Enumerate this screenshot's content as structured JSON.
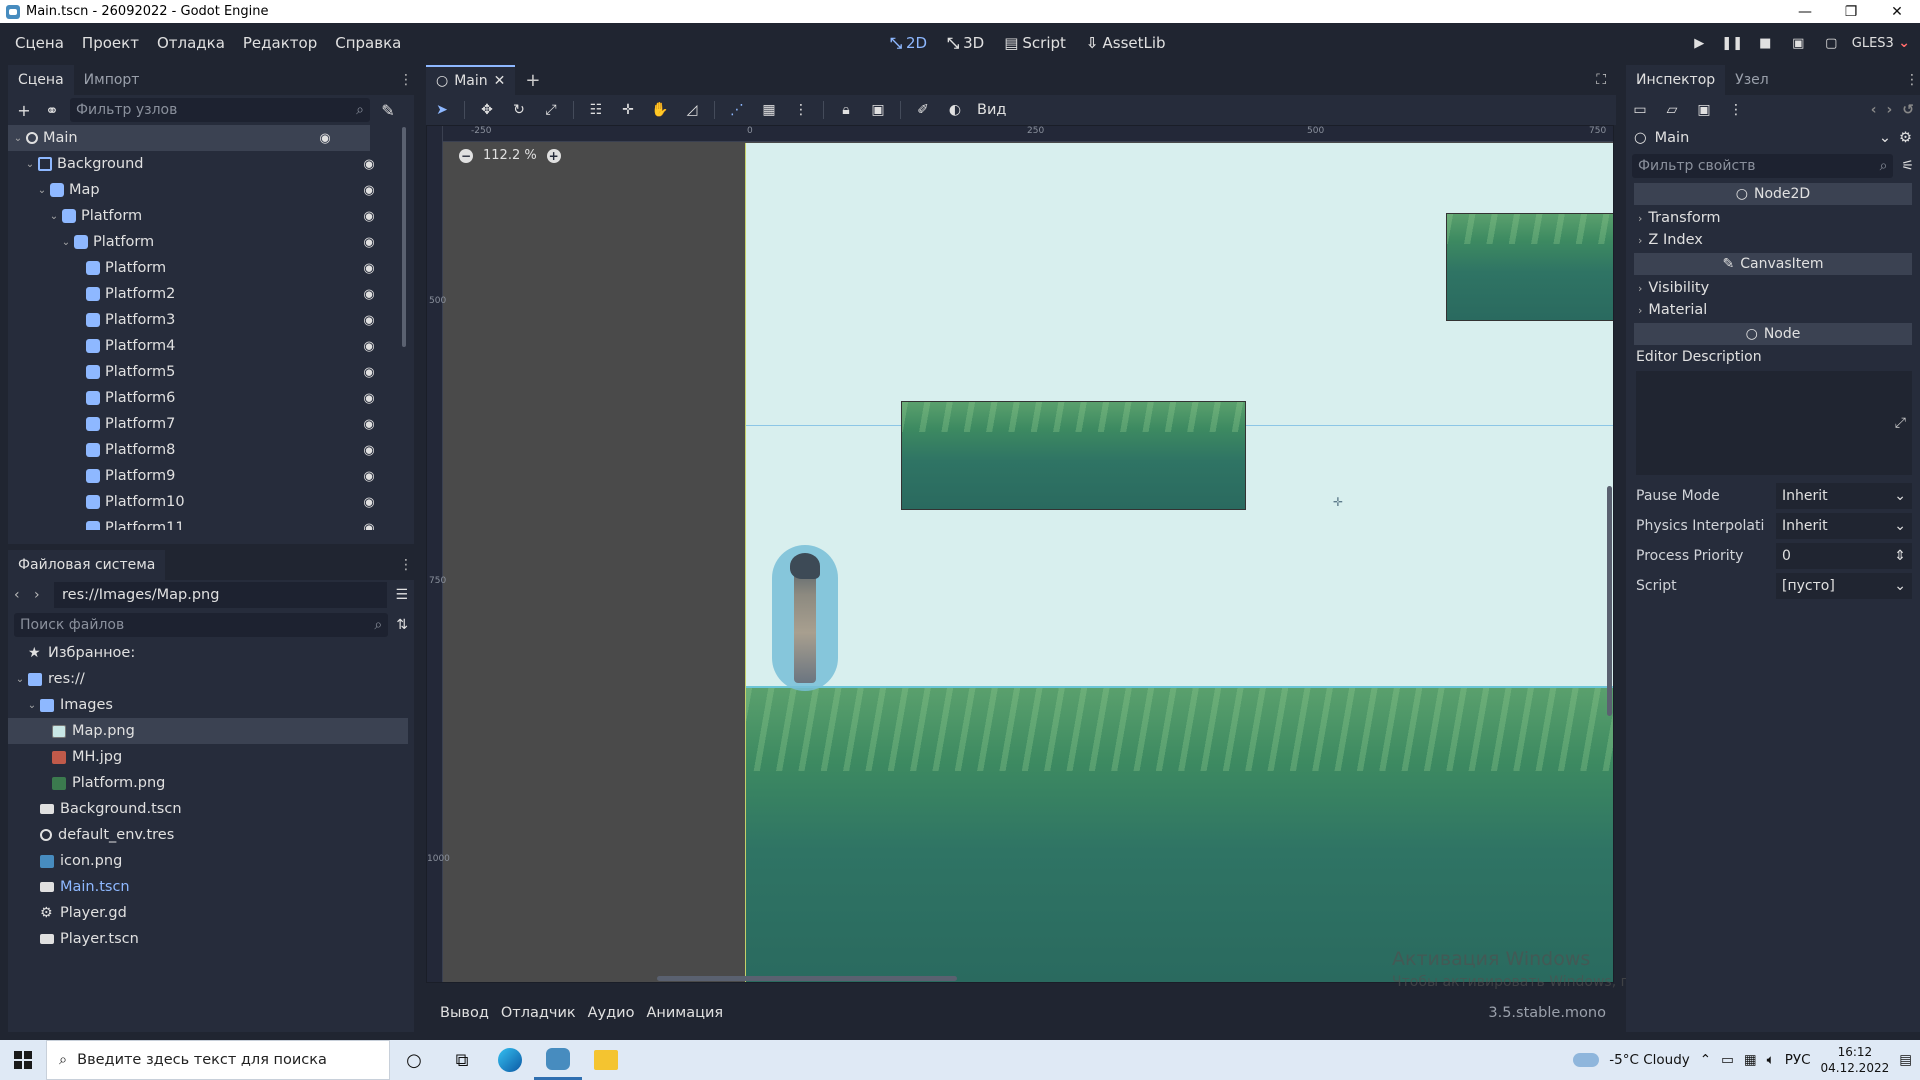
{
  "window": {
    "title": "Main.tscn - 26092022 - Godot Engine",
    "controls": [
      "—",
      "❐",
      "✕"
    ]
  },
  "menubar": {
    "menu": [
      "Сцена",
      "Проект",
      "Отладка",
      "Редактор",
      "Справка"
    ],
    "modes": [
      {
        "label": "2D",
        "icon": "2d-icon",
        "active": true
      },
      {
        "label": "3D",
        "icon": "3d-icon",
        "active": false
      },
      {
        "label": "Script",
        "icon": "script-icon",
        "active": false
      },
      {
        "label": "AssetLib",
        "icon": "assetlib-icon",
        "active": false
      }
    ],
    "renderer": "GLES3"
  },
  "scene_dock": {
    "tabs": [
      "Сцена",
      "Импорт"
    ],
    "filter_placeholder": "Фильтр узлов",
    "tree": [
      {
        "label": "Main",
        "type": "node",
        "depth": 0,
        "expanded": true,
        "selected": true
      },
      {
        "label": "Background",
        "type": "bg",
        "depth": 1,
        "expanded": true
      },
      {
        "label": "Map",
        "type": "tile",
        "depth": 2,
        "expanded": true
      },
      {
        "label": "Platform",
        "type": "tile",
        "depth": 3,
        "expanded": true
      },
      {
        "label": "Platform",
        "type": "tile",
        "depth": 4,
        "expanded": true
      },
      {
        "label": "Platform",
        "type": "tile",
        "depth": 5
      },
      {
        "label": "Platform2",
        "type": "tile",
        "depth": 5
      },
      {
        "label": "Platform3",
        "type": "tile",
        "depth": 5
      },
      {
        "label": "Platform4",
        "type": "tile",
        "depth": 5
      },
      {
        "label": "Platform5",
        "type": "tile",
        "depth": 5
      },
      {
        "label": "Platform6",
        "type": "tile",
        "depth": 5
      },
      {
        "label": "Platform7",
        "type": "tile",
        "depth": 5
      },
      {
        "label": "Platform8",
        "type": "tile",
        "depth": 5
      },
      {
        "label": "Platform9",
        "type": "tile",
        "depth": 5
      },
      {
        "label": "Platform10",
        "type": "tile",
        "depth": 5
      },
      {
        "label": "Platform11",
        "type": "tile",
        "depth": 5
      }
    ]
  },
  "filesystem_dock": {
    "title": "Файловая система",
    "path": "res://Images/Map.png",
    "search_placeholder": "Поиск файлов",
    "entries": [
      {
        "label": "Избранное:",
        "icon": "star",
        "depth": 0
      },
      {
        "label": "res://",
        "icon": "folder",
        "depth": 0,
        "expanded": true
      },
      {
        "label": "Images",
        "icon": "folder",
        "depth": 1,
        "expanded": true
      },
      {
        "label": "Map.png",
        "icon": "img",
        "depth": 2,
        "selected": true
      },
      {
        "label": "MH.jpg",
        "icon": "jpg",
        "depth": 2
      },
      {
        "label": "Platform.png",
        "icon": "plat",
        "depth": 2
      },
      {
        "label": "Background.tscn",
        "icon": "scene",
        "depth": 1
      },
      {
        "label": "default_env.tres",
        "icon": "env",
        "depth": 1
      },
      {
        "label": "icon.png",
        "icon": "icon",
        "depth": 1
      },
      {
        "label": "Main.tscn",
        "icon": "scene",
        "depth": 1,
        "highlight": true
      },
      {
        "label": "Player.gd",
        "icon": "gear",
        "depth": 1
      },
      {
        "label": "Player.tscn",
        "icon": "scene",
        "depth": 1
      }
    ]
  },
  "center": {
    "scene_tab": "Main",
    "view_menu": "Вид",
    "zoom": "112.2 %",
    "ruler_top": [
      "-250",
      "0",
      "250",
      "500",
      "750"
    ],
    "ruler_left": [
      "500",
      "750",
      "1000"
    ]
  },
  "watermark": {
    "title": "Активация Windows",
    "subtitle": "Чтобы активировать Windows, перейдите в раздел \"Параметры\"."
  },
  "bottom_panel": {
    "tabs": [
      "Вывод",
      "Отладчик",
      "Аудио",
      "Анимация"
    ],
    "version": "3.5.stable.mono"
  },
  "inspector": {
    "tabs": [
      "Инспектор",
      "Узел"
    ],
    "node_name": "Main",
    "filter_placeholder": "Фильтр свойств",
    "sections": {
      "node2d": "Node2D",
      "canvasitem": "CanvasItem",
      "node": "Node"
    },
    "node2d_groups": [
      "Transform",
      "Z Index"
    ],
    "canvasitem_groups": [
      "Visibility",
      "Material"
    ],
    "editor_description": "Editor Description",
    "properties": [
      {
        "name": "Pause Mode",
        "value": "Inherit",
        "control": "dropdown"
      },
      {
        "name": "Physics Interpolati",
        "value": "Inherit",
        "control": "dropdown"
      },
      {
        "name": "Process Priority",
        "value": "0",
        "control": "spinner"
      },
      {
        "name": "Script",
        "value": "[пусто]",
        "control": "dropdown"
      }
    ]
  },
  "taskbar": {
    "search_placeholder": "Введите здесь текст для поиска",
    "weather": "-5°C  Cloudy",
    "lang": "РУС",
    "time": "16:12",
    "date": "04.12.2022"
  },
  "colors": {
    "accent": "#8eb8ff",
    "panel": "#262c3b",
    "background": "#202531",
    "sky": "#d8efee",
    "grass": "#3d8a61"
  }
}
